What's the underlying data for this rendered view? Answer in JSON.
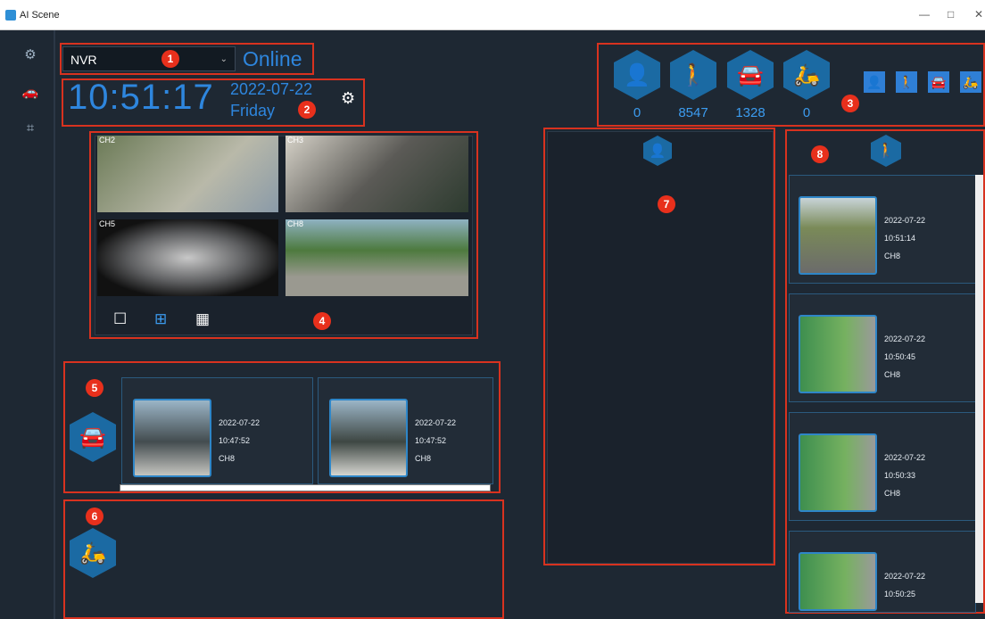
{
  "window": {
    "title": "AI Scene",
    "min": "—",
    "max": "□",
    "close": "✕"
  },
  "sidebar": {
    "icons": [
      "settings-sliders-icon",
      "car-icon",
      "face-scan-icon"
    ]
  },
  "device": {
    "selected": "NVR",
    "status": "Online"
  },
  "clock": {
    "time": "10:51:17",
    "date": "2022-07-22",
    "day": "Friday"
  },
  "counters": [
    {
      "icon": "face-icon",
      "value": "0"
    },
    {
      "icon": "pedestrian-icon",
      "value": "8547"
    },
    {
      "icon": "vehicle-icon",
      "value": "1328"
    },
    {
      "icon": "motorbike-icon",
      "value": "0"
    }
  ],
  "markers": [
    "1",
    "2",
    "3",
    "4",
    "5",
    "6",
    "7",
    "8"
  ],
  "cameras": [
    "CH2",
    "CH3",
    "CH5",
    "CH8"
  ],
  "vehicle_records": [
    {
      "date": "2022-07-22",
      "time": "10:47:52",
      "channel": "CH8"
    },
    {
      "date": "2022-07-22",
      "time": "10:47:52",
      "channel": "CH8"
    }
  ],
  "pedestrian_records": [
    {
      "date": "2022-07-22",
      "time": "10:51:14",
      "channel": "CH8"
    },
    {
      "date": "2022-07-22",
      "time": "10:50:45",
      "channel": "CH8"
    },
    {
      "date": "2022-07-22",
      "time": "10:50:33",
      "channel": "CH8"
    },
    {
      "date": "2022-07-22",
      "time": "10:50:25",
      "channel": ""
    }
  ],
  "colors": {
    "accent": "#2e86de",
    "marker": "#e8301c",
    "background": "#1e2833"
  }
}
